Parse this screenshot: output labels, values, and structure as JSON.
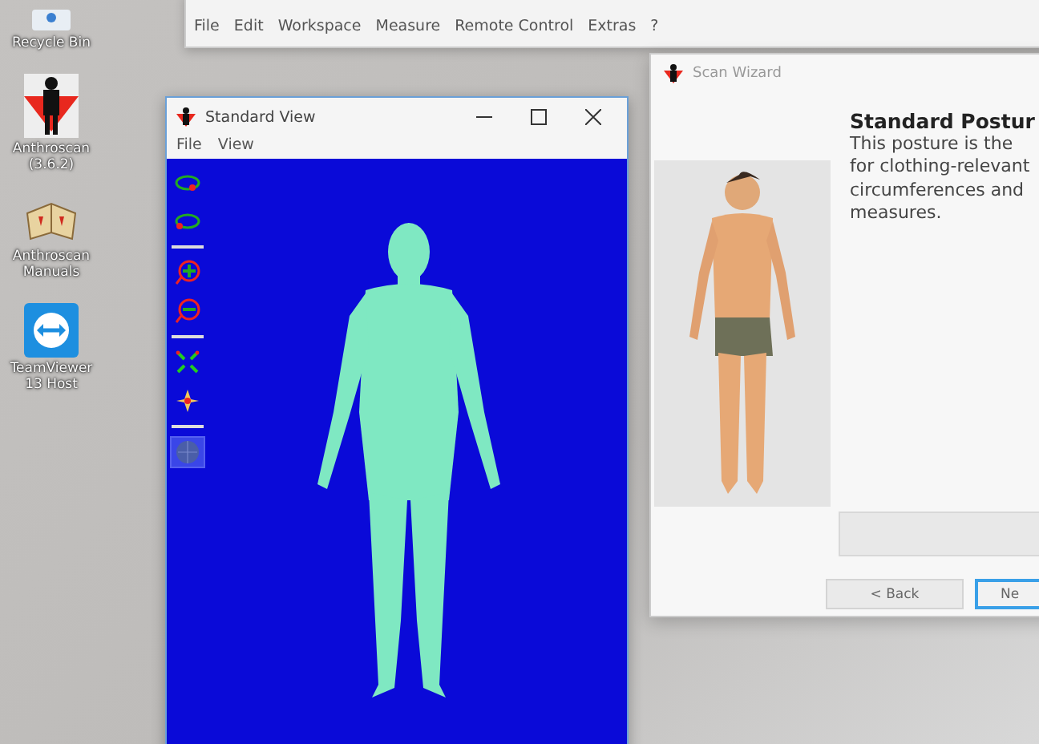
{
  "desktop_icons": [
    {
      "kind": "recycle",
      "label": "Recycle Bin"
    },
    {
      "kind": "anthroscan",
      "label": "Anthroscan (3.6.2)"
    },
    {
      "kind": "manuals",
      "label": "Anthroscan Manuals"
    },
    {
      "kind": "teamviewer",
      "label": "TeamViewer 13 Host"
    }
  ],
  "main_window": {
    "menu": [
      "File",
      "Edit",
      "Workspace",
      "Measure",
      "Remote Control",
      "Extras",
      "?"
    ]
  },
  "standard_view": {
    "title": "Standard View",
    "menu": [
      "File",
      "View"
    ],
    "tools": [
      {
        "kind": "rotate-left",
        "selected": false
      },
      {
        "kind": "rotate-right",
        "selected": false
      },
      {
        "kind": "zoom-in",
        "selected": false
      },
      {
        "kind": "zoom-out",
        "selected": false
      },
      {
        "kind": "fit",
        "selected": false
      },
      {
        "kind": "pan",
        "selected": false
      },
      {
        "kind": "sphere",
        "selected": true
      }
    ]
  },
  "scan_wizard": {
    "title": "Scan Wizard",
    "heading": "Standard Postur",
    "lines": [
      "This posture is the",
      "for clothing-relevant",
      "circumferences and",
      "measures."
    ],
    "buttons": [
      {
        "label": "< Back",
        "default": false
      },
      {
        "label": "Ne",
        "default": true
      }
    ]
  }
}
